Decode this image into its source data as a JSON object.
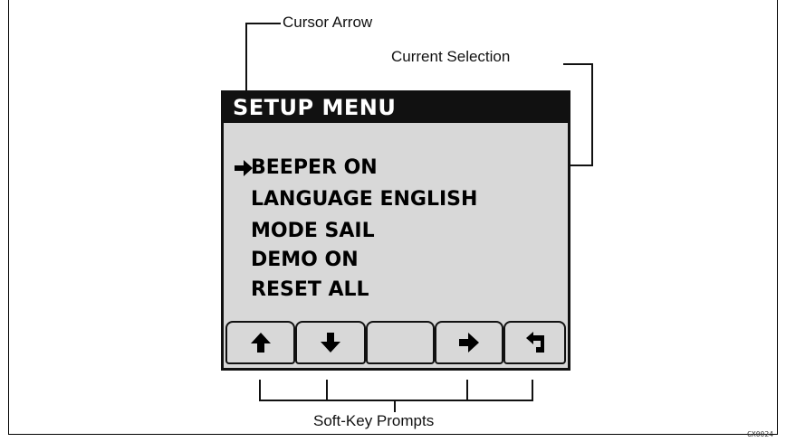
{
  "callouts": {
    "cursor_arrow": "Cursor Arrow",
    "current_selection": "Current Selection",
    "soft_key_prompts": "Soft-Key Prompts"
  },
  "screen": {
    "title": "SETUP MENU",
    "cursor_glyph": "➔",
    "items": [
      {
        "label": "BEEPER ON",
        "selected": true
      },
      {
        "label": "LANGUAGE ENGLISH",
        "selected": false
      },
      {
        "label": "MODE SAIL",
        "selected": false
      },
      {
        "label": "DEMO ON",
        "selected": false
      },
      {
        "label": "RESET ALL",
        "selected": false
      }
    ],
    "softkeys": [
      {
        "icon": "up-arrow-icon"
      },
      {
        "icon": "down-arrow-icon"
      },
      {
        "icon": ""
      },
      {
        "icon": "right-arrow-icon"
      },
      {
        "icon": "return-arrow-icon"
      }
    ]
  },
  "figure_id": "GX0024"
}
